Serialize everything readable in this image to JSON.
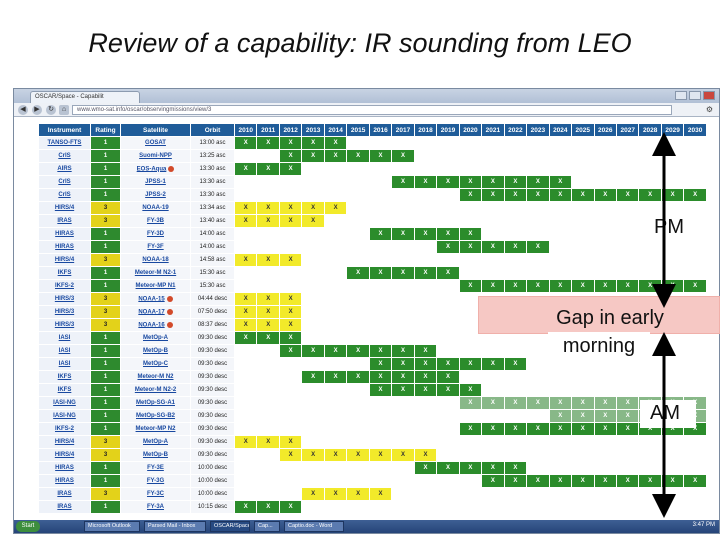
{
  "slide": {
    "title": "Review of a capability: IR sounding from LEO"
  },
  "browser": {
    "tab_title": "OSCAR/Space - Capabilit",
    "url": "www.wmo-sat.info/oscar/observingmissions/view/3",
    "taskbar": {
      "start": "Start",
      "items": [
        "Microsoft Outlook",
        "Parsed Mail - Inbox",
        "OSCAR/Space",
        "Cap...",
        "Captio.doc - Word"
      ],
      "time": "3:47 PM"
    }
  },
  "table": {
    "headers": [
      "Instrument",
      "Rating",
      "Satellite",
      "Orbit",
      "2010",
      "2011",
      "2012",
      "2013",
      "2014",
      "2015",
      "2016",
      "2017",
      "2018",
      "2019",
      "2020",
      "2021",
      "2022",
      "2023",
      "2024",
      "2025",
      "2026",
      "2027",
      "2028",
      "2029",
      "2030"
    ],
    "start_year": 2010,
    "rows": [
      {
        "instrument": "TANSO-FTS",
        "rating": "1",
        "satellite": "GOSAT",
        "orbit": "13:00 asc",
        "warn": false,
        "cells": "GGGGG................"
      },
      {
        "instrument": "CrIS",
        "rating": "1",
        "satellite": "Suomi-NPP",
        "orbit": "13:25 asc",
        "warn": false,
        "cells": "..GGGGGG............."
      },
      {
        "instrument": "AIRS",
        "rating": "1",
        "satellite": "EOS-Aqua",
        "orbit": "13:30 asc",
        "warn": true,
        "cells": "GGG.................."
      },
      {
        "instrument": "CrIS",
        "rating": "1",
        "satellite": "JPSS-1",
        "orbit": "13:30 asc",
        "warn": false,
        "cells": ".......GGGGGGGG......"
      },
      {
        "instrument": "CrIS",
        "rating": "1",
        "satellite": "JPSS-2",
        "orbit": "13:30 asc",
        "warn": false,
        "cells": "..........GGGGGGGGGGG"
      },
      {
        "instrument": "HIRS/4",
        "rating": "3",
        "satellite": "NOAA-19",
        "orbit": "13:34 asc",
        "warn": false,
        "cells": "YYYYY................"
      },
      {
        "instrument": "IRAS",
        "rating": "3",
        "satellite": "FY-3B",
        "orbit": "13:40 asc",
        "warn": false,
        "cells": "YYYY................."
      },
      {
        "instrument": "HIRAS",
        "rating": "1",
        "satellite": "FY-3D",
        "orbit": "14:00 asc",
        "warn": false,
        "cells": "......GGGGG.........."
      },
      {
        "instrument": "HIRAS",
        "rating": "1",
        "satellite": "FY-3F",
        "orbit": "14:00 asc",
        "warn": false,
        "cells": ".........GGGGG......."
      },
      {
        "instrument": "HIRS/4",
        "rating": "3",
        "satellite": "NOAA-18",
        "orbit": "14:58 asc",
        "warn": false,
        "cells": "YYY.................."
      },
      {
        "instrument": "IKFS",
        "rating": "1",
        "satellite": "Meteor-M N2-1",
        "orbit": "15:30 asc",
        "warn": false,
        "cells": ".....GGGGG..........."
      },
      {
        "instrument": "IKFS-2",
        "rating": "1",
        "satellite": "Meteor-MP N1",
        "orbit": "15:30 asc",
        "warn": false,
        "cells": "..........GGGGGGGGGGG"
      },
      {
        "instrument": "HIRS/3",
        "rating": "3",
        "satellite": "NOAA-15",
        "orbit": "04:44 desc",
        "warn": true,
        "cells": "YYY.................."
      },
      {
        "instrument": "HIRS/3",
        "rating": "3",
        "satellite": "NOAA-17",
        "orbit": "07:50 desc",
        "warn": true,
        "cells": "YYY.................."
      },
      {
        "instrument": "HIRS/3",
        "rating": "3",
        "satellite": "NOAA-16",
        "orbit": "08:37 desc",
        "warn": true,
        "cells": "YYY.................."
      },
      {
        "instrument": "IASI",
        "rating": "1",
        "satellite": "MetOp-A",
        "orbit": "09:30 desc",
        "warn": false,
        "cells": "GGG.................."
      },
      {
        "instrument": "IASI",
        "rating": "1",
        "satellite": "MetOp-B",
        "orbit": "09:30 desc",
        "warn": false,
        "cells": "..GGGGGGG............"
      },
      {
        "instrument": "IASI",
        "rating": "1",
        "satellite": "MetOp-C",
        "orbit": "09:30 desc",
        "warn": false,
        "cells": "......GGGGGGG........"
      },
      {
        "instrument": "IKFS",
        "rating": "1",
        "satellite": "Meteor-M N2",
        "orbit": "09:30 desc",
        "warn": false,
        "cells": "...GGGGGGG..........."
      },
      {
        "instrument": "IKFS",
        "rating": "1",
        "satellite": "Meteor-M N2-2",
        "orbit": "09:30 desc",
        "warn": false,
        "cells": "......GGGGG.........."
      },
      {
        "instrument": "IASI-NG",
        "rating": "1",
        "satellite": "MetOp-SG-A1",
        "orbit": "09:30 desc",
        "warn": false,
        "cells": "..........LLLLLLLLLLL"
      },
      {
        "instrument": "IASI-NG",
        "rating": "1",
        "satellite": "MetOp-SG-B2",
        "orbit": "09:30 desc",
        "warn": false,
        "cells": "..............LLLLLLL"
      },
      {
        "instrument": "IKFS-2",
        "rating": "1",
        "satellite": "Meteor-MP N2",
        "orbit": "09:30 desc",
        "warn": false,
        "cells": "..........GGGGGGGGGGG"
      },
      {
        "instrument": "HIRS/4",
        "rating": "3",
        "satellite": "MetOp-A",
        "orbit": "09:30 desc",
        "warn": false,
        "cells": "YYY.................."
      },
      {
        "instrument": "HIRS/4",
        "rating": "3",
        "satellite": "MetOp-B",
        "orbit": "09:30 desc",
        "warn": false,
        "cells": "..YYYYYYY............"
      },
      {
        "instrument": "HIRAS",
        "rating": "1",
        "satellite": "FY-3E",
        "orbit": "10:00 desc",
        "warn": false,
        "cells": "........GGGGG........"
      },
      {
        "instrument": "HIRAS",
        "rating": "1",
        "satellite": "FY-3G",
        "orbit": "10:00 desc",
        "warn": false,
        "cells": "...........GGGGGGGGGG"
      },
      {
        "instrument": "IRAS",
        "rating": "3",
        "satellite": "FY-3C",
        "orbit": "10:00 desc",
        "warn": false,
        "cells": "...YYYY.............."
      },
      {
        "instrument": "IRAS",
        "rating": "1",
        "satellite": "FY-3A",
        "orbit": "10:15 desc",
        "warn": false,
        "cells": "GGG.................."
      }
    ],
    "mark": "X"
  },
  "annotations": {
    "pm": "PM",
    "gap_line1": "Gap in early",
    "gap_line2": "morning",
    "am": "AM"
  },
  "colors": {
    "header_blue": "#1f5c99",
    "active_green": "#2b8c2b",
    "planned_green": "#88b888",
    "rating3_yellow": "#f2ea2a",
    "gap_pink": "#f6c8c4"
  }
}
